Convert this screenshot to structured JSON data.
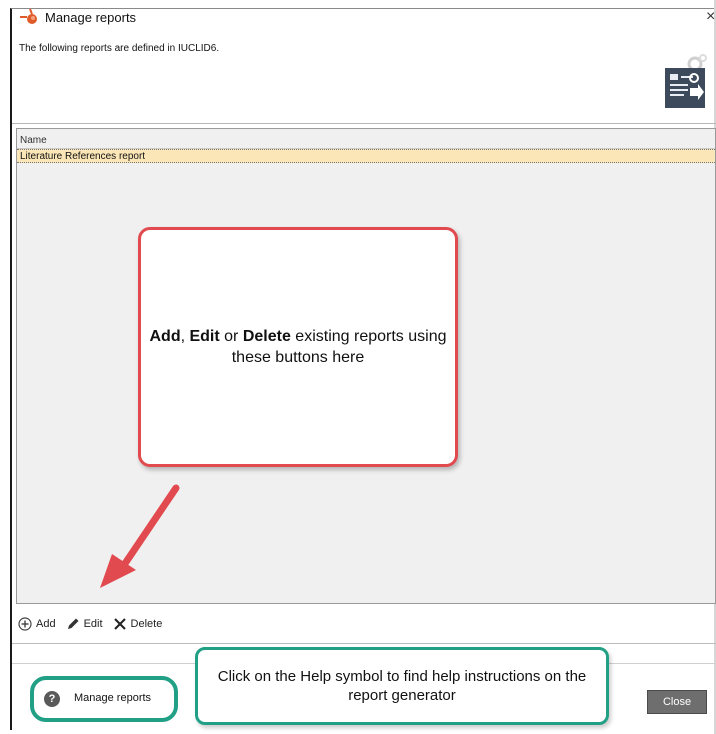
{
  "window": {
    "title": "Manage reports",
    "close_glyph": "×",
    "subtitle": "The following reports are defined in IUCLID6.",
    "report_icon": "report-generator-icon"
  },
  "table": {
    "column_header": "Name",
    "rows": [
      {
        "name": "Literature References report",
        "selected": true
      }
    ]
  },
  "toolbar": {
    "add_label": "Add",
    "edit_label": "Edit",
    "delete_label": "Delete"
  },
  "callouts": {
    "buttons_bold_add": "Add",
    "buttons_sep1": ", ",
    "buttons_bold_edit": "Edit",
    "buttons_or": " or ",
    "buttons_bold_delete": "Delete",
    "buttons_rest": " existing reports using these buttons here",
    "help_text": "Click on the Help symbol to find help instructions on the report generator"
  },
  "footer": {
    "help_glyph": "?",
    "help_label": "Manage reports",
    "close_label": "Close"
  },
  "colors": {
    "selected_row": "#fbe6b8",
    "callout_red": "#e14a4f",
    "callout_teal": "#21a085",
    "panel_bg": "#f0f0f0"
  }
}
